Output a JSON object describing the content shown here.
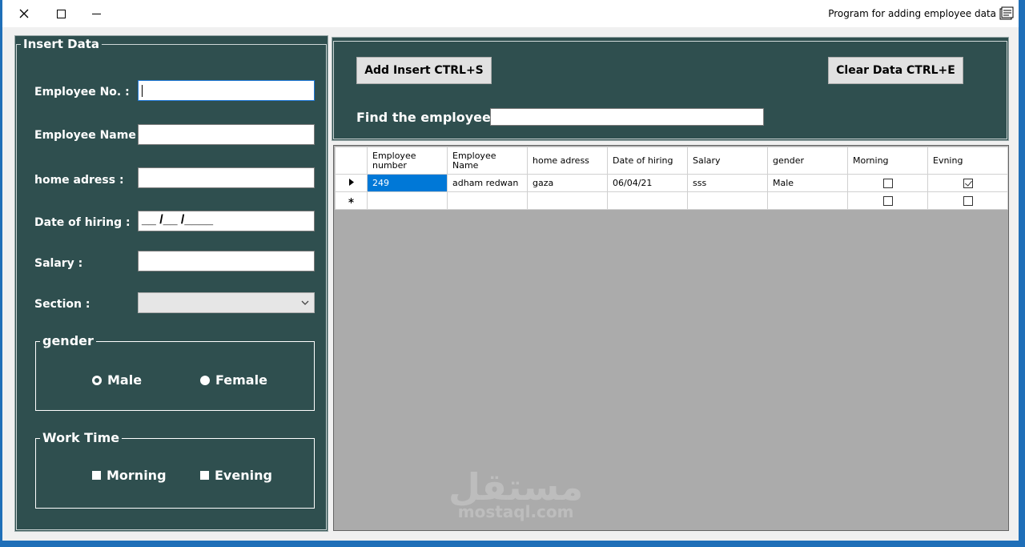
{
  "window": {
    "title": "Program for adding employee data",
    "controls": [
      "close-icon",
      "maximize-icon",
      "minimize-icon"
    ]
  },
  "insert_panel": {
    "legend": "Insert Data",
    "employee_no_label": "Employee No. :",
    "employee_no_value": "",
    "employee_name_label": "Employee Name :",
    "employee_name_value": "",
    "home_address_label": "home adress :",
    "home_address_value": "",
    "hiring_date_label": "Date of hiring :",
    "hiring_date_mask": "__ /__ /____",
    "salary_label": "Salary :",
    "salary_value": "",
    "section_label": "Section :",
    "section_value": "",
    "gender": {
      "legend": "gender",
      "options": [
        "Male",
        "Female"
      ],
      "selected": "Male"
    },
    "work_time": {
      "legend": "Work Time",
      "options": [
        "Morning",
        "Evening"
      ]
    }
  },
  "toolbar": {
    "add_label": "Add Insert CTRL+S",
    "clear_label": "Clear Data CTRL+E",
    "find_label": "Find the employee :",
    "find_value": ""
  },
  "grid": {
    "columns": [
      "Employee number",
      "Employee Name",
      "home adress",
      "Date of hiring",
      "Salary",
      "gender",
      "Morning",
      "Evning"
    ],
    "rows": [
      {
        "number": "249",
        "name": "adham redwan",
        "address": "gaza",
        "date": "06/04/21",
        "salary": "sss",
        "gender": "Male",
        "morning": false,
        "evening": true
      }
    ]
  },
  "watermark": {
    "arabic": "مستقل",
    "latin": "mostaql.com"
  },
  "colors": {
    "panel": "#2f4f4f",
    "selection": "#0078d7",
    "grid_bg": "#ababab"
  }
}
